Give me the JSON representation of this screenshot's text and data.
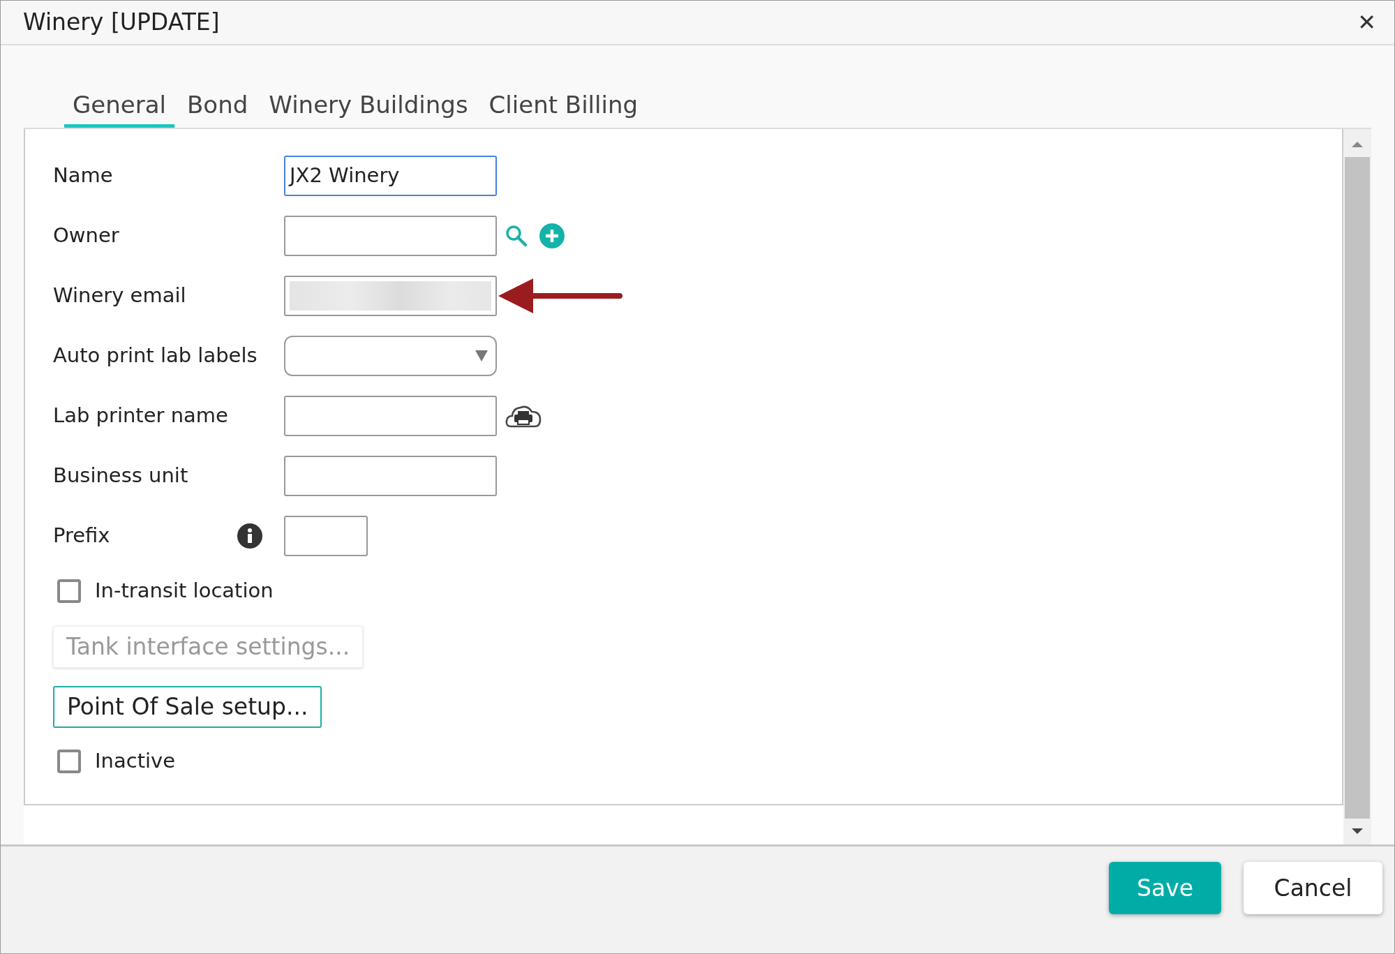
{
  "window": {
    "title": "Winery [UPDATE]",
    "close": "✕"
  },
  "tabs": [
    {
      "label": "General",
      "selected": true
    },
    {
      "label": "Bond",
      "selected": false
    },
    {
      "label": "Winery Buildings",
      "selected": false
    },
    {
      "label": "Client Billing",
      "selected": false
    }
  ],
  "fields": [
    {
      "label": "Name",
      "kind": "text",
      "value": "JX2 Winery",
      "focused": true
    },
    {
      "label": "Owner",
      "kind": "text",
      "focused": false,
      "search": true,
      "add": true
    },
    {
      "label": "Winery email",
      "kind": "blurred",
      "focused": false,
      "pointer_arrow": true
    },
    {
      "label": "Auto print lab labels",
      "kind": "select",
      "focused": false
    },
    {
      "label": "Lab printer name",
      "kind": "text",
      "focused": false,
      "printer": true
    },
    {
      "label": "Business unit",
      "kind": "text",
      "focused": false
    },
    {
      "label": "Prefix",
      "kind": "short",
      "focused": false,
      "info": true
    }
  ],
  "options": [
    {
      "kind": "checkbox",
      "label": "In-transit location",
      "checked": false
    },
    {
      "kind": "button",
      "label": "Tank interface settings...",
      "disabled": true
    },
    {
      "kind": "button",
      "label": "Point Of Sale setup...",
      "disabled": false
    },
    {
      "kind": "checkbox",
      "label": "Inactive",
      "checked": false
    }
  ],
  "footer": [
    {
      "label": "Save",
      "primary": true
    },
    {
      "label": "Cancel",
      "primary": false
    }
  ]
}
